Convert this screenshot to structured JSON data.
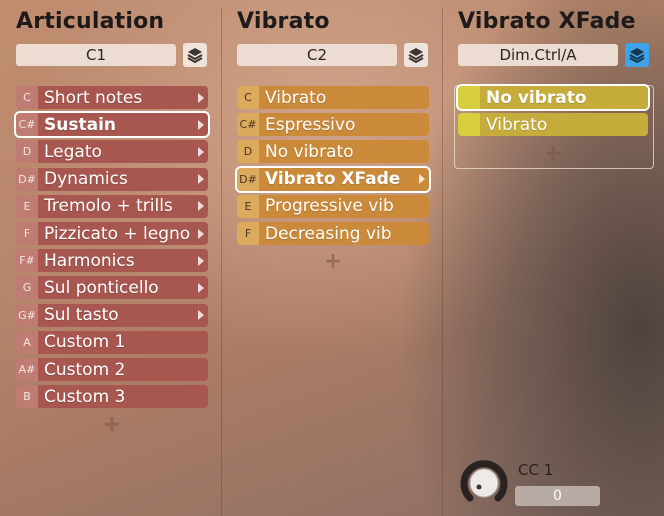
{
  "articulation": {
    "title": "Articulation",
    "key": "C1",
    "items": [
      {
        "key": "C",
        "label": "Short notes",
        "arrow": true
      },
      {
        "key": "C#",
        "label": "Sustain",
        "arrow": true,
        "selected": true
      },
      {
        "key": "D",
        "label": "Legato",
        "arrow": true
      },
      {
        "key": "D#",
        "label": "Dynamics",
        "arrow": true
      },
      {
        "key": "E",
        "label": "Tremolo + trills",
        "arrow": true
      },
      {
        "key": "F",
        "label": "Pizzicato + legno",
        "arrow": true
      },
      {
        "key": "F#",
        "label": "Harmonics",
        "arrow": true
      },
      {
        "key": "G",
        "label": "Sul ponticello",
        "arrow": true
      },
      {
        "key": "G#",
        "label": "Sul tasto",
        "arrow": true
      },
      {
        "key": "A",
        "label": "Custom 1",
        "arrow": false
      },
      {
        "key": "A#",
        "label": "Custom 2",
        "arrow": false
      },
      {
        "key": "B",
        "label": "Custom 3",
        "arrow": false
      }
    ],
    "add_symbol": "+"
  },
  "vibrato": {
    "title": "Vibrato",
    "key": "C2",
    "items": [
      {
        "key": "C",
        "label": "Vibrato",
        "arrow": false
      },
      {
        "key": "C#",
        "label": "Espressivo",
        "arrow": false
      },
      {
        "key": "D",
        "label": "No vibrato",
        "arrow": false
      },
      {
        "key": "D#",
        "label": "Vibrato XFade",
        "arrow": true,
        "selected": true
      },
      {
        "key": "E",
        "label": "Progressive vib",
        "arrow": false
      },
      {
        "key": "F",
        "label": "Decreasing vib",
        "arrow": false
      }
    ],
    "add_symbol": "+"
  },
  "xfade": {
    "title": "Vibrato XFade",
    "key": "Dim.Ctrl/A",
    "items": [
      {
        "label": "No vibrato",
        "selected": true
      },
      {
        "label": "Vibrato"
      }
    ],
    "add_symbol": "+",
    "cc_label": "CC 1",
    "cc_value": "0"
  },
  "icons": {
    "layers": "layers-icon",
    "arrow": "chevron-right-icon",
    "knob": "knob-icon"
  },
  "colors": {
    "articulation_row": "#a7574f",
    "vibrato_row": "#cb8a3a",
    "xfade_row": "#c6ad3b",
    "active_button": "#3ea3e8"
  }
}
